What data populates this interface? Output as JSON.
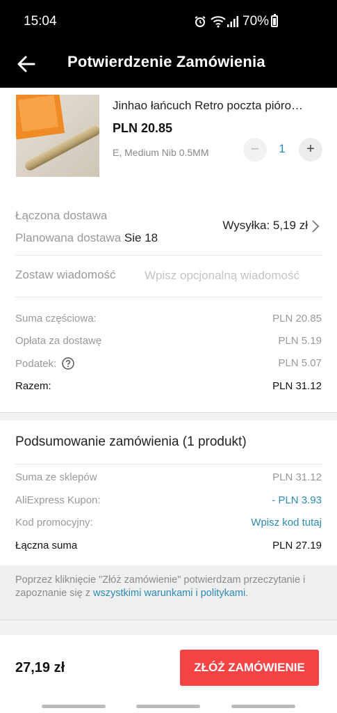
{
  "status_bar": {
    "time": "15:04",
    "battery_percent": "70%",
    "icons": [
      "alarm-icon",
      "wifi-icon",
      "signal-icon",
      "battery-icon"
    ]
  },
  "app_bar": {
    "title": "Potwierdzenie Zamówienia",
    "back_icon": "arrow-left-icon"
  },
  "product": {
    "title": "Jinhao łańcuch Retro poczta pióro…",
    "price": "PLN 20.85",
    "variant": "E, Medium Nib 0.5MM",
    "quantity": "1",
    "minus_label": "−",
    "plus_label": "+"
  },
  "delivery": {
    "combined_label": "Łączona dostawa",
    "planned_label": "Planowana dostawa",
    "planned_date": "Sie 18",
    "shipping": "Wysyłka: 5,19 zł"
  },
  "message": {
    "label": "Zostaw wiadomość",
    "placeholder": "Wpisz opcjonalną wiadomość"
  },
  "costs": {
    "subtotal_label": "Suma częściowa:",
    "subtotal_value": "PLN 20.85",
    "delivery_fee_label": "Opłata za dostawę",
    "delivery_fee_value": "PLN 5.19",
    "tax_label": "Podatek:",
    "tax_value": "PLN 5.07",
    "total_label": "Razem:",
    "total_value": "PLN 31.12"
  },
  "summary": {
    "title": "Podsumowanie zamówienia (1 produkt)",
    "stores_label": "Suma ze sklepów",
    "stores_value": "PLN 31.12",
    "coupon_label": "AliExpress Kupon:",
    "coupon_value": "- PLN 3.93",
    "promo_label": "Kod promocyjny:",
    "promo_value": "Wpisz kod tutaj",
    "grand_total_label": "Łączna suma",
    "grand_total_value": "PLN 27.19"
  },
  "terms": {
    "text": "Poprzez kliknięcie \"Złóż zamówienie\" potwierdzam przeczytanie i zapoznanie się z ",
    "link": "wszystkimi warunkami i politykami",
    "end": "."
  },
  "bottom_bar": {
    "total": "27,19 zł",
    "place_order": "ZŁÓŻ ZAMÓWIENIE"
  },
  "colors": {
    "accent_blue": "#2a8ab3",
    "order_button": "#f24444",
    "header_bg": "#000000"
  }
}
